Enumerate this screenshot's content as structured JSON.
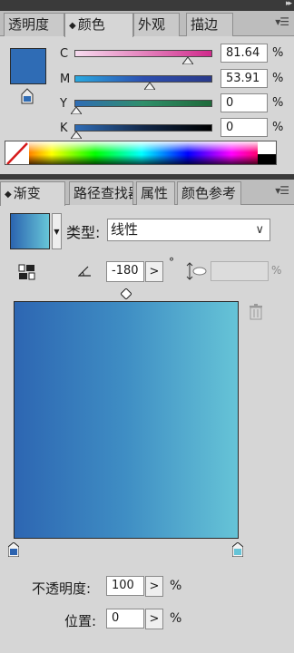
{
  "colors": {
    "accent_blue": "#2f6cb5",
    "gradient_start": "#2c63b0",
    "gradient_end": "#66c4d7"
  },
  "color_panel": {
    "tabs": [
      {
        "label": "透明度"
      },
      {
        "label": "颜色",
        "active": true
      },
      {
        "label": "外观"
      },
      {
        "label": "描边"
      }
    ],
    "channels": [
      {
        "letter": "C",
        "value": "81.64",
        "unit": "%"
      },
      {
        "letter": "M",
        "value": "53.91",
        "unit": "%"
      },
      {
        "letter": "Y",
        "value": "0",
        "unit": "%"
      },
      {
        "letter": "K",
        "value": "0",
        "unit": "%"
      }
    ]
  },
  "gradient_panel": {
    "tabs": [
      {
        "label": "渐变",
        "active": true
      },
      {
        "label": "路径查找器"
      },
      {
        "label": "属性"
      },
      {
        "label": "颜色参考"
      }
    ],
    "type_label": "类型:",
    "type_value": "线性",
    "angle_value": "-180",
    "degree_symbol": "°",
    "aspect_unit": "%",
    "opacity_label": "不透明度:",
    "opacity_value": "100",
    "opacity_unit": "%",
    "location_label": "位置:",
    "location_value": "0",
    "location_unit": "%"
  }
}
